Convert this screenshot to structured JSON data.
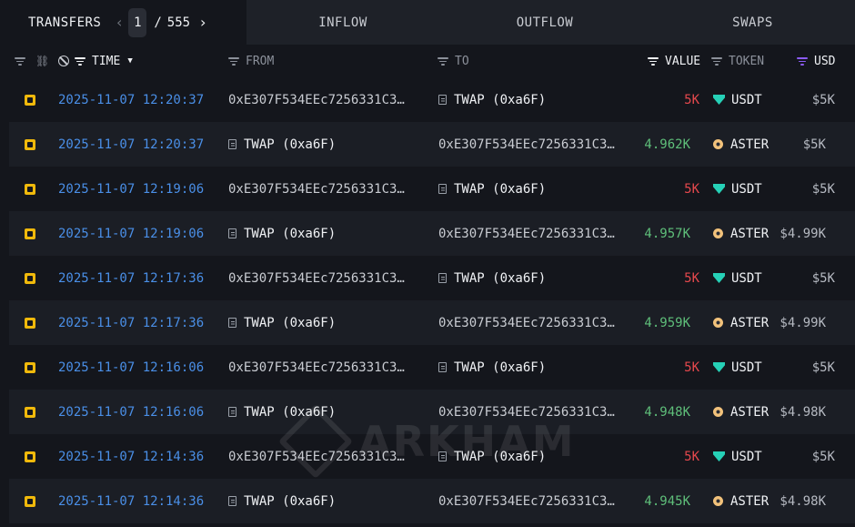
{
  "tabs": {
    "transfers": "TRANSFERS",
    "inflow": "INFLOW",
    "outflow": "OUTFLOW",
    "swaps": "SWAPS"
  },
  "pager": {
    "current": "1",
    "separator": "/",
    "total": "555",
    "prev_icon": "chevron-left-icon",
    "next_icon": "chevron-right-icon"
  },
  "columns": {
    "time": "TIME",
    "from": "FROM",
    "to": "TO",
    "value": "VALUE",
    "token": "TOKEN",
    "usd": "USD"
  },
  "colors": {
    "time": "#4a8fe7",
    "value_out": "#e5484d",
    "value_in": "#5fbf7a",
    "usd_filter": "#8b5cf6",
    "chain_icon": "#f0b90b"
  },
  "rows": [
    {
      "time": "2025-11-07 12:20:37",
      "from": "0xE307F534EEc7256331C3…",
      "from_is_entity": false,
      "to": "TWAP (0xa6F)",
      "to_is_entity": true,
      "value": "5K",
      "value_dir": "out",
      "token": "USDT",
      "usd": "$5K"
    },
    {
      "time": "2025-11-07 12:20:37",
      "from": "TWAP (0xa6F)",
      "from_is_entity": true,
      "to": "0xE307F534EEc7256331C3…",
      "to_is_entity": false,
      "value": "4.962K",
      "value_dir": "in",
      "token": "ASTER",
      "usd": "$5K"
    },
    {
      "time": "2025-11-07 12:19:06",
      "from": "0xE307F534EEc7256331C3…",
      "from_is_entity": false,
      "to": "TWAP (0xa6F)",
      "to_is_entity": true,
      "value": "5K",
      "value_dir": "out",
      "token": "USDT",
      "usd": "$5K"
    },
    {
      "time": "2025-11-07 12:19:06",
      "from": "TWAP (0xa6F)",
      "from_is_entity": true,
      "to": "0xE307F534EEc7256331C3…",
      "to_is_entity": false,
      "value": "4.957K",
      "value_dir": "in",
      "token": "ASTER",
      "usd": "$4.99K"
    },
    {
      "time": "2025-11-07 12:17:36",
      "from": "0xE307F534EEc7256331C3…",
      "from_is_entity": false,
      "to": "TWAP (0xa6F)",
      "to_is_entity": true,
      "value": "5K",
      "value_dir": "out",
      "token": "USDT",
      "usd": "$5K"
    },
    {
      "time": "2025-11-07 12:17:36",
      "from": "TWAP (0xa6F)",
      "from_is_entity": true,
      "to": "0xE307F534EEc7256331C3…",
      "to_is_entity": false,
      "value": "4.959K",
      "value_dir": "in",
      "token": "ASTER",
      "usd": "$4.99K"
    },
    {
      "time": "2025-11-07 12:16:06",
      "from": "0xE307F534EEc7256331C3…",
      "from_is_entity": false,
      "to": "TWAP (0xa6F)",
      "to_is_entity": true,
      "value": "5K",
      "value_dir": "out",
      "token": "USDT",
      "usd": "$5K"
    },
    {
      "time": "2025-11-07 12:16:06",
      "from": "TWAP (0xa6F)",
      "from_is_entity": true,
      "to": "0xE307F534EEc7256331C3…",
      "to_is_entity": false,
      "value": "4.948K",
      "value_dir": "in",
      "token": "ASTER",
      "usd": "$4.98K"
    },
    {
      "time": "2025-11-07 12:14:36",
      "from": "0xE307F534EEc7256331C3…",
      "from_is_entity": false,
      "to": "TWAP (0xa6F)",
      "to_is_entity": true,
      "value": "5K",
      "value_dir": "out",
      "token": "USDT",
      "usd": "$5K"
    },
    {
      "time": "2025-11-07 12:14:36",
      "from": "TWAP (0xa6F)",
      "from_is_entity": true,
      "to": "0xE307F534EEc7256331C3…",
      "to_is_entity": false,
      "value": "4.945K",
      "value_dir": "in",
      "token": "ASTER",
      "usd": "$4.98K"
    }
  ],
  "watermark": "ARKHAM"
}
